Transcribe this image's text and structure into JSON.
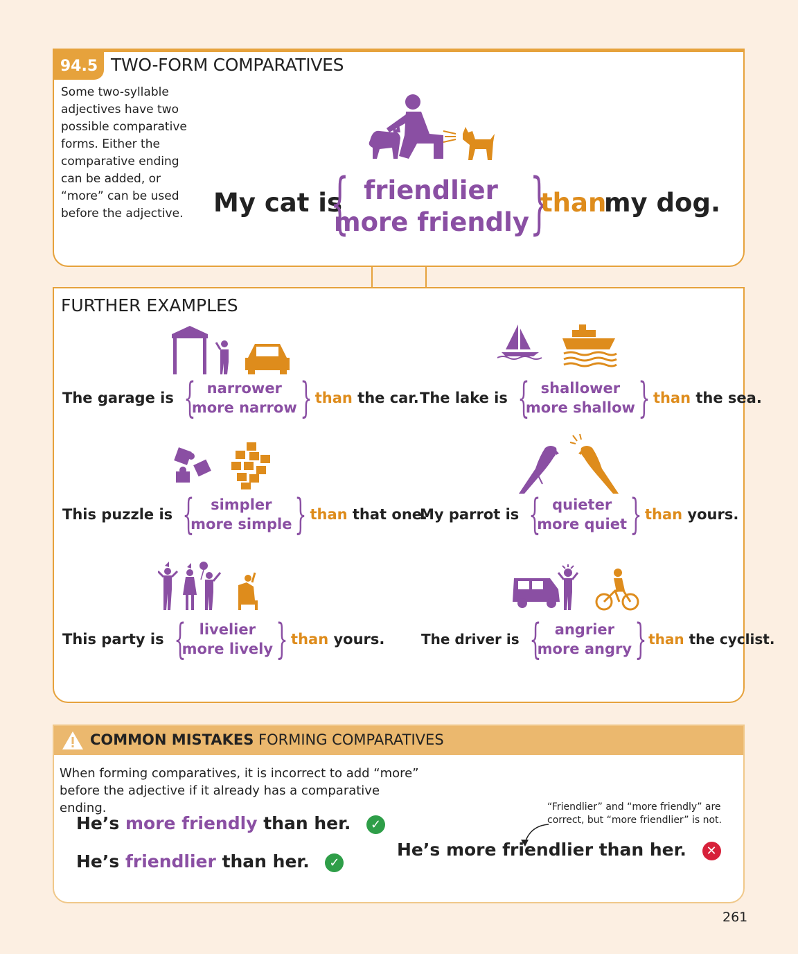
{
  "section": {
    "number": "94.5",
    "title": "TWO-FORM COMPARATIVES",
    "intro": "Some two-syllable adjectives have two possible comparative forms. Either the comparative ending can be added, or “more” can be used before the adjective."
  },
  "main_example": {
    "start": "My cat is",
    "option1": "friendlier",
    "option2": "more friendly",
    "than": "than",
    "end": "my dog."
  },
  "further_title": "FURTHER EXAMPLES",
  "examples": [
    {
      "start": "The garage is",
      "option1": "narrower",
      "option2": "more narrow",
      "than": "than",
      "end": "the car."
    },
    {
      "start": "The lake is",
      "option1": "shallower",
      "option2": "more shallow",
      "than": "than",
      "end": "the sea."
    },
    {
      "start": "This puzzle is",
      "option1": "simpler",
      "option2": "more simple",
      "than": "than",
      "end": "that one."
    },
    {
      "start": "My parrot is",
      "option1": "quieter",
      "option2": "more quiet",
      "than": "than",
      "end": "yours."
    },
    {
      "start": "This party is",
      "option1": "livelier",
      "option2": "more lively",
      "than": "than",
      "end": "yours."
    },
    {
      "start": "The driver is",
      "option1": "angrier",
      "option2": "more angry",
      "than": "than",
      "end": "the cyclist."
    }
  ],
  "common_mistakes": {
    "title_bold": "COMMON MISTAKES",
    "title_rest": "FORMING COMPARATIVES",
    "text": "When forming comparatives, it is incorrect to add “more” before the adjective if it already has a comparative ending.",
    "correct1": {
      "pre": "He’s",
      "hl": "more friendly",
      "post": "than her."
    },
    "correct2": {
      "pre": "He’s",
      "hl": "friendlier",
      "post": "than her."
    },
    "wrong": "He’s more friendlier than her.",
    "note": "“Friendlier” and “more friendly” are correct, but “more friendlier” is not."
  },
  "page_number": "261",
  "colors": {
    "purple": "#8a4fa3",
    "orange": "#de8c1c",
    "accent": "#e6a23c",
    "tick": "#2e9e48",
    "cross": "#d7213a"
  },
  "icons": [
    "person-petting-cat-icon",
    "barking-dog-icon",
    "garage-icon",
    "person-icon",
    "car-icon",
    "sailboat-icon",
    "ship-icon",
    "puzzle-pieces-icon",
    "parrot-icon",
    "party-people-icon",
    "person-in-armchair-icon",
    "van-icon",
    "angry-driver-icon",
    "cyclist-icon",
    "warning-icon",
    "check-icon",
    "cross-icon"
  ]
}
